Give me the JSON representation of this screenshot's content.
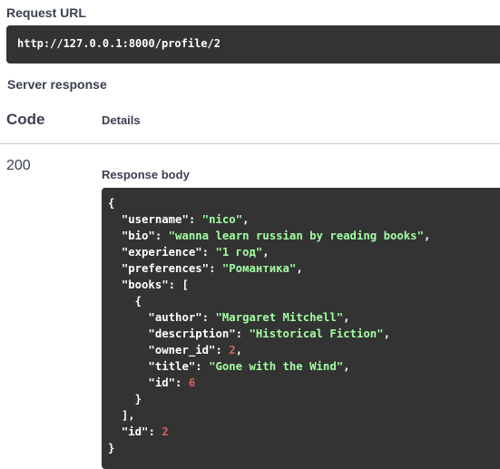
{
  "request_url": {
    "label": "Request URL",
    "value": "http://127.0.0.1:8000/profile/2"
  },
  "server_response": {
    "label": "Server response",
    "columns": {
      "code": "Code",
      "details": "Details"
    },
    "status_code": "200",
    "response_body": {
      "label": "Response body",
      "json": {
        "username": "nico",
        "bio": "wanna learn russian by reading books",
        "experience": "1 год",
        "preferences": "Романтика",
        "books": [
          {
            "author": "Margaret Mitchell",
            "description": "Historical Fiction",
            "owner_id": 2,
            "title": "Gone with the Wind",
            "id": 6
          }
        ],
        "id": 2
      }
    }
  },
  "colors": {
    "code_bg": "#333333",
    "json_string": "#a2fca2",
    "json_number": "#d36363",
    "text": "#3b4151"
  }
}
